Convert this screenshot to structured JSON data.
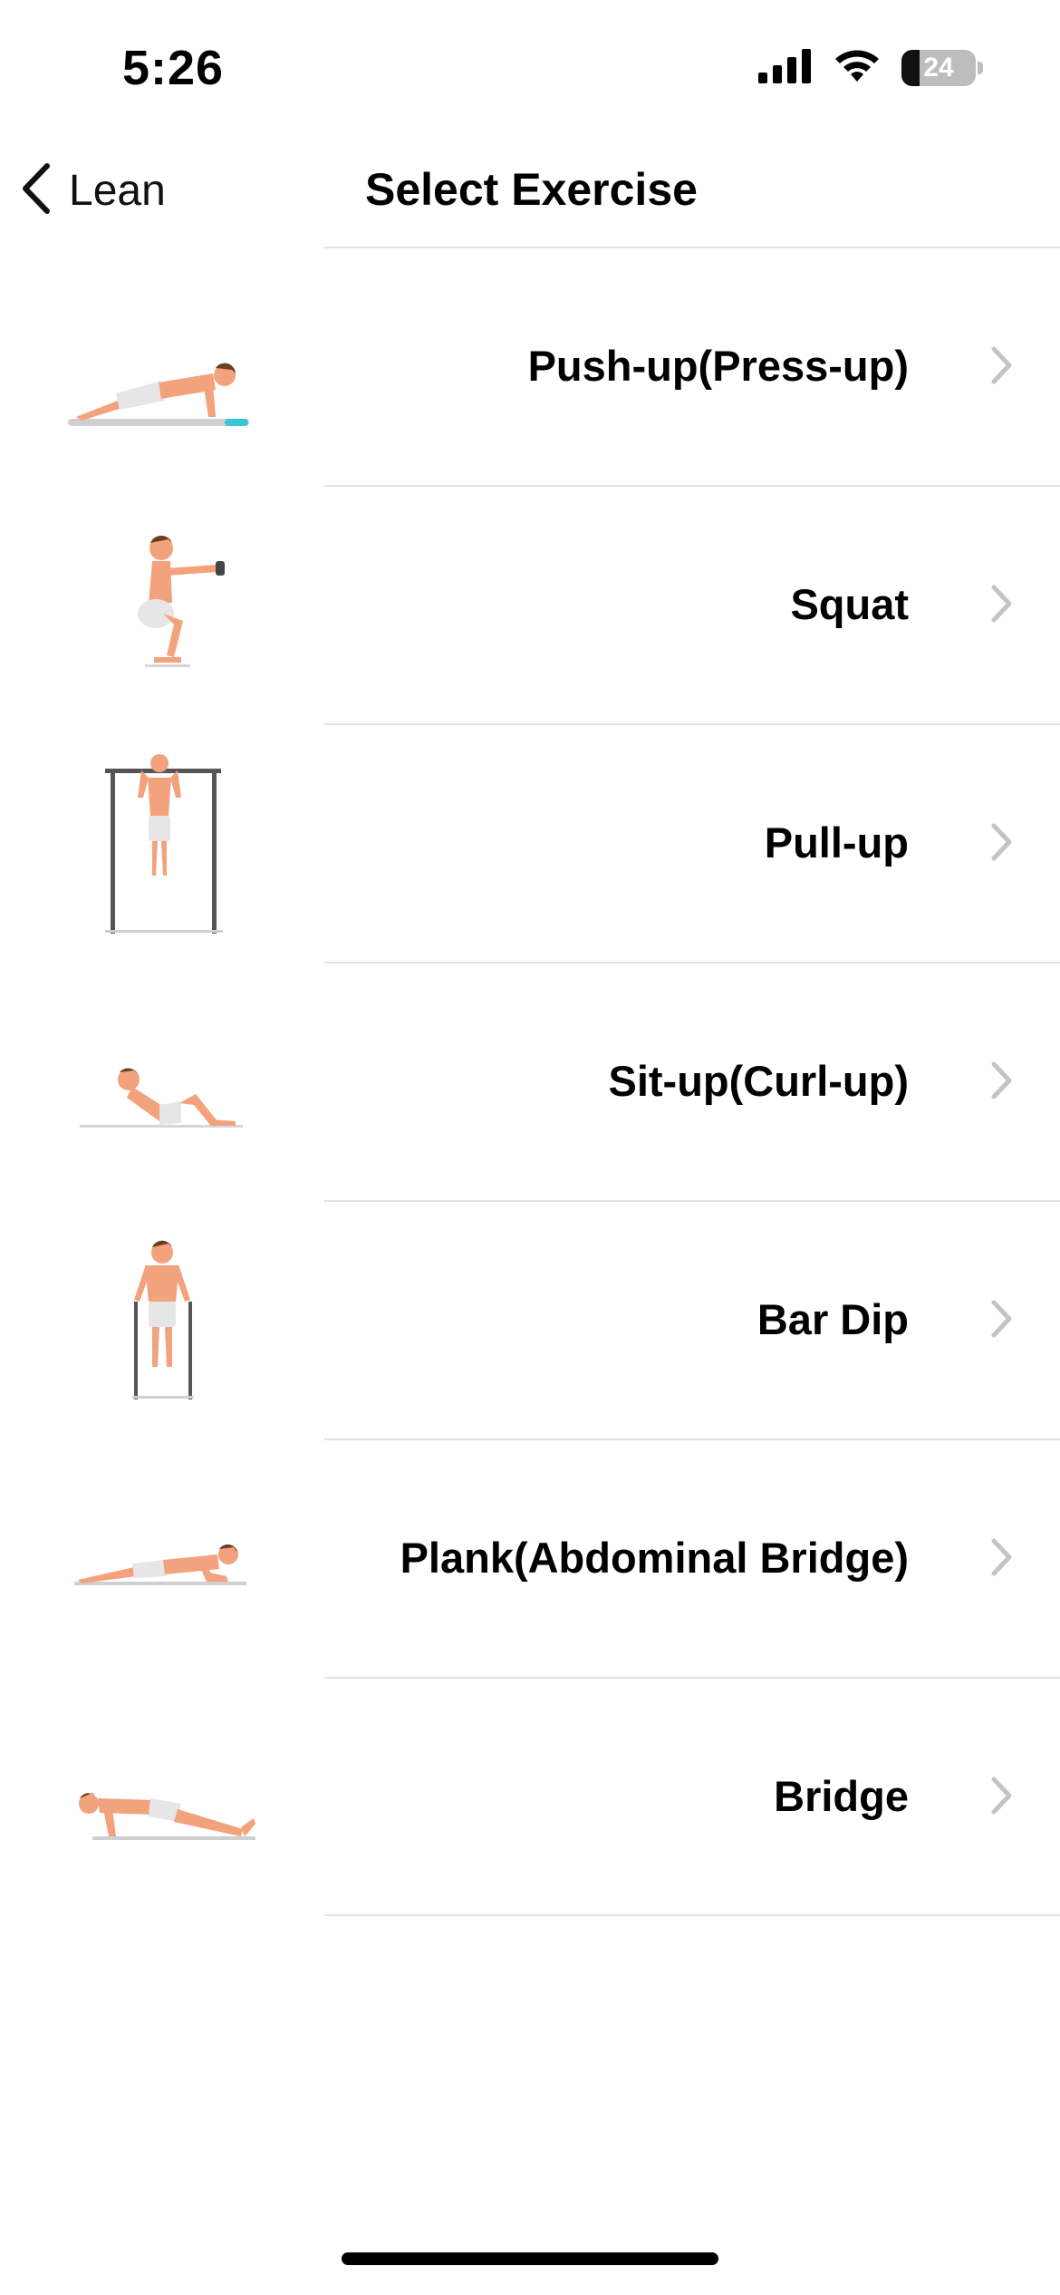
{
  "status_bar": {
    "time": "5:26",
    "battery_level": "24",
    "battery_fraction": 0.24,
    "icons": [
      "cellular-signal-icon",
      "wifi-icon",
      "battery-icon"
    ]
  },
  "nav": {
    "back_label": "Lean",
    "title": "Select Exercise"
  },
  "exercises": [
    {
      "label": "Push-up(Press-up)",
      "figure": "push-up-figure-icon"
    },
    {
      "label": "Squat",
      "figure": "squat-figure-icon"
    },
    {
      "label": "Pull-up",
      "figure": "pull-up-figure-icon"
    },
    {
      "label": "Sit-up(Curl-up)",
      "figure": "sit-up-figure-icon"
    },
    {
      "label": "Bar Dip",
      "figure": "bar-dip-figure-icon"
    },
    {
      "label": "Plank(Abdominal Bridge)",
      "figure": "plank-figure-icon"
    },
    {
      "label": "Bridge",
      "figure": "bridge-figure-icon"
    }
  ],
  "colors": {
    "skin": "#f2a27c",
    "shorts": "#e6e6e6",
    "hair": "#6b3d22",
    "bar": "#555555",
    "chevron": "#c4c4c8",
    "divider": "#e2e2e2"
  }
}
